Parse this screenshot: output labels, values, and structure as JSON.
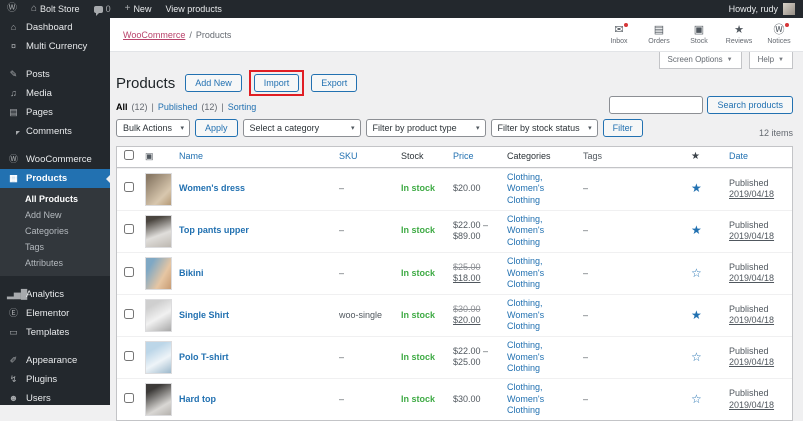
{
  "colors": {
    "accent_blue": "#2271b1",
    "instock_green": "#3fab45",
    "annotation_red": "#e01e24",
    "admin_dark": "#23282d",
    "breadcrumb_pink": "#b8436b"
  },
  "admin_bar": {
    "wp_logo_glyph": "Ⓦ",
    "home_glyph": "⌂",
    "site_name": "Bolt Store",
    "comments_count": "0",
    "plus_glyph": "+",
    "new_label": "New",
    "view_products_label": "View products",
    "howdy": "Howdy, rudy"
  },
  "sidebar": {
    "items": [
      {
        "label": "Dashboard",
        "icon": "⌂"
      },
      {
        "label": "Multi Currency",
        "icon": "¤"
      },
      {
        "label": "Posts",
        "icon": "✎"
      },
      {
        "label": "Media",
        "icon": "♫"
      },
      {
        "label": "Pages",
        "icon": "▤"
      },
      {
        "label": "Comments",
        "icon": ""
      },
      {
        "label": "WooCommerce",
        "icon": "Ⓦ"
      },
      {
        "label": "Products",
        "icon": "▦"
      },
      {
        "label": "Analytics",
        "icon": "▂▅█"
      },
      {
        "label": "Elementor",
        "icon": "Ⓔ"
      },
      {
        "label": "Templates",
        "icon": "▭"
      },
      {
        "label": "Appearance",
        "icon": "✐"
      },
      {
        "label": "Plugins",
        "icon": "↯"
      },
      {
        "label": "Users",
        "icon": "☻"
      }
    ],
    "products_submenu": [
      {
        "label": "All Products",
        "current": true
      },
      {
        "label": "Add New",
        "current": false
      },
      {
        "label": "Categories",
        "current": false
      },
      {
        "label": "Tags",
        "current": false
      },
      {
        "label": "Attributes",
        "current": false
      }
    ]
  },
  "header": {
    "breadcrumb_link": "WooCommerce",
    "breadcrumb_sep": "/",
    "breadcrumb_current": "Products",
    "activity": [
      {
        "label": "Inbox",
        "icon": "✉",
        "dot": true
      },
      {
        "label": "Orders",
        "icon": "▤",
        "dot": false
      },
      {
        "label": "Stock",
        "icon": "▣",
        "dot": false
      },
      {
        "label": "Reviews",
        "icon": "★",
        "dot": false
      },
      {
        "label": "Notices",
        "icon": "Ⓦ",
        "dot": true
      }
    ],
    "screen_options_label": "Screen Options",
    "help_label": "Help",
    "caret": "▼"
  },
  "page": {
    "title": "Products",
    "add_new_label": "Add New",
    "import_label": "Import",
    "export_label": "Export",
    "views": {
      "all_label": "All",
      "all_count": "(12)",
      "published_label": "Published",
      "published_count": "(12)",
      "sorting_label": "Sorting",
      "sep": "|"
    },
    "bulk_actions_label": "Bulk Actions",
    "apply_label": "Apply",
    "category_filter_label": "Select a category",
    "type_filter_label": "Filter by product type",
    "stock_filter_label": "Filter by stock status",
    "filter_label": "Filter",
    "search_value": "",
    "search_button_label": "Search products",
    "items_count": "12 items",
    "select_caret": "▾"
  },
  "table": {
    "columns": {
      "image_glyph": "▣",
      "name": "Name",
      "sku": "SKU",
      "stock": "Stock",
      "price": "Price",
      "categories": "Categories",
      "tags": "Tags",
      "star": "★",
      "date": "Date"
    },
    "rows": [
      {
        "name": "Women's dress",
        "sku": "–",
        "stock": "In stock",
        "price1": "$20.00",
        "price1_del": false,
        "price2": "",
        "price2_ins": false,
        "categories": "Clothing, Women's Clothing",
        "tags": "–",
        "star": "★",
        "status": "Published",
        "date": "2019/04/18"
      },
      {
        "name": "Top pants upper",
        "sku": "–",
        "stock": "In stock",
        "price1": "$22.00 –",
        "price1_del": false,
        "price2": "$89.00",
        "price2_ins": false,
        "categories": "Clothing, Women's Clothing",
        "tags": "–",
        "star": "★",
        "status": "Published",
        "date": "2019/04/18"
      },
      {
        "name": "Bikini",
        "sku": "–",
        "stock": "In stock",
        "price1": "$25.00",
        "price1_del": true,
        "price2": "$18.00",
        "price2_ins": true,
        "categories": "Clothing, Women's Clothing",
        "tags": "–",
        "star": "☆",
        "status": "Published",
        "date": "2019/04/18"
      },
      {
        "name": "Single Shirt",
        "sku": "woo-single",
        "stock": "In stock",
        "price1": "$30.00",
        "price1_del": true,
        "price2": "$20.00",
        "price2_ins": true,
        "categories": "Clothing, Women's Clothing",
        "tags": "–",
        "star": "★",
        "status": "Published",
        "date": "2019/04/18"
      },
      {
        "name": "Polo T-shirt",
        "sku": "–",
        "stock": "In stock",
        "price1": "$22.00 –",
        "price1_del": false,
        "price2": "$25.00",
        "price2_ins": false,
        "categories": "Clothing, Women's Clothing",
        "tags": "–",
        "star": "☆",
        "status": "Published",
        "date": "2019/04/18"
      },
      {
        "name": "Hard top",
        "sku": "–",
        "stock": "In stock",
        "price1": "$30.00",
        "price1_del": false,
        "price2": "",
        "price2_ins": false,
        "categories": "Clothing, Women's Clothing",
        "tags": "–",
        "star": "☆",
        "status": "Published",
        "date": "2019/04/18"
      }
    ]
  }
}
